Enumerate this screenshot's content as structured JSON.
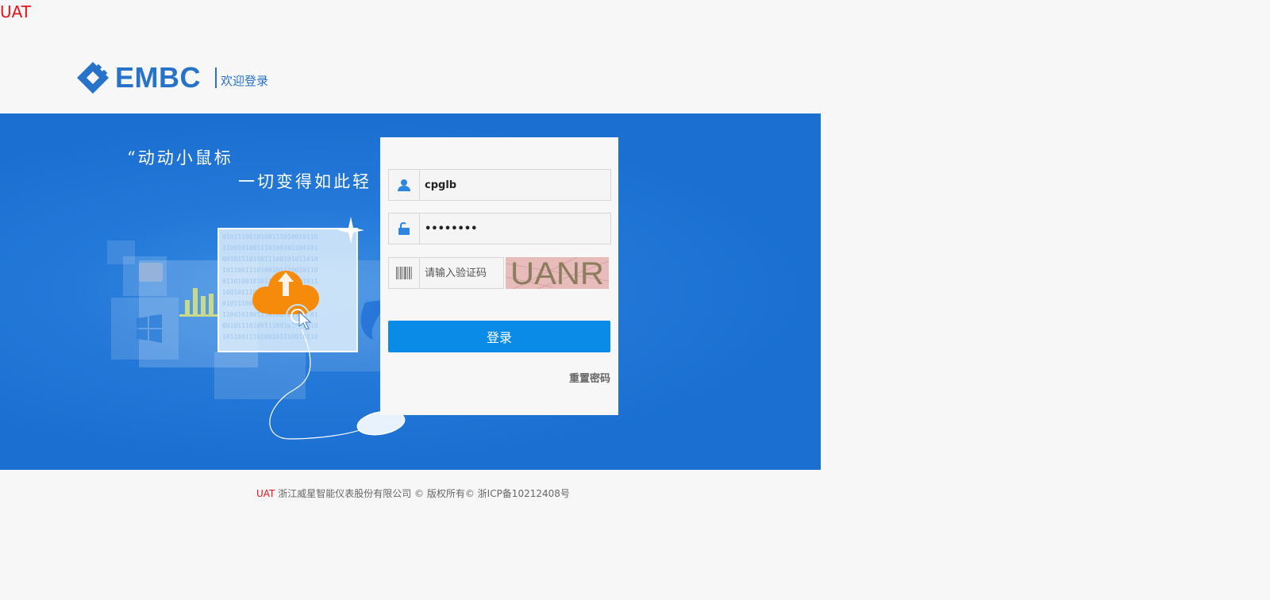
{
  "env_tag": "UAT",
  "header": {
    "brand_name": "EMBC",
    "welcome": "欢迎登录",
    "logo_icon": "embc-logo-icon",
    "brand_color": "#2673c9"
  },
  "banner": {
    "slogan_line1": "“动动小鼠标",
    "slogan_line2": "一切变得如此轻",
    "background_color": "#1a6fd0",
    "illustration": "cloud-upload-mouse-illustration"
  },
  "login": {
    "username": {
      "value": "cpglb",
      "icon": "user-icon"
    },
    "password": {
      "value": "••••••••",
      "icon": "unlock-icon"
    },
    "captcha": {
      "placeholder": "请输入验证码",
      "icon": "barcode-icon",
      "image_text": "UANR"
    },
    "submit_label": "登录",
    "submit_color": "#0b8be8",
    "reset_password": "重置密码"
  },
  "footer": {
    "env": "UAT",
    "text": " 浙江威星智能仪表股份有限公司 © 版权所有© 浙ICP备10212408号"
  }
}
